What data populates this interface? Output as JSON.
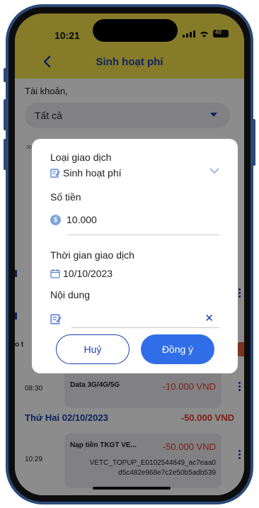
{
  "status_bar": {
    "time": "10:21",
    "battery": "40"
  },
  "header": {
    "title": "Sinh hoạt phí"
  },
  "account": {
    "label": "Tài khoản,",
    "selected": "Tất cả"
  },
  "chart_axis_label": "300.000",
  "background_list": {
    "peek_text": "o t",
    "card1": {
      "time": "08:30",
      "name": "Data 3G/4G/5G",
      "amount": "-10.000 VND"
    },
    "day2": {
      "label": "Thứ Hai 02/10/2023",
      "total": "-50.000 VND"
    },
    "card2": {
      "time": "10:29",
      "name": "Nạp tiền TKGT VE...",
      "amount": "-50.000 VND",
      "note_line1": "VETC_TOPUP_E0102544849_ac7eaa0",
      "note_line2": "d5c482e968e7c2e50b5adb539"
    }
  },
  "modal": {
    "type_label": "Loại giao dịch",
    "type_value": "Sinh hoạt phí",
    "amount_label": "Số tiền",
    "amount_value": "10.000",
    "time_label": "Thời gian giao dịch",
    "date_value": "10/10/2023",
    "content_label": "Nội dung",
    "content_value": "",
    "cancel_label": "Huỷ",
    "confirm_label": "Đồng ý"
  },
  "colors": {
    "header_bg": "#f4e14c",
    "accent_blue": "#1d3fae",
    "button_blue": "#2f6ee6",
    "negative_red": "#e23a2b"
  }
}
